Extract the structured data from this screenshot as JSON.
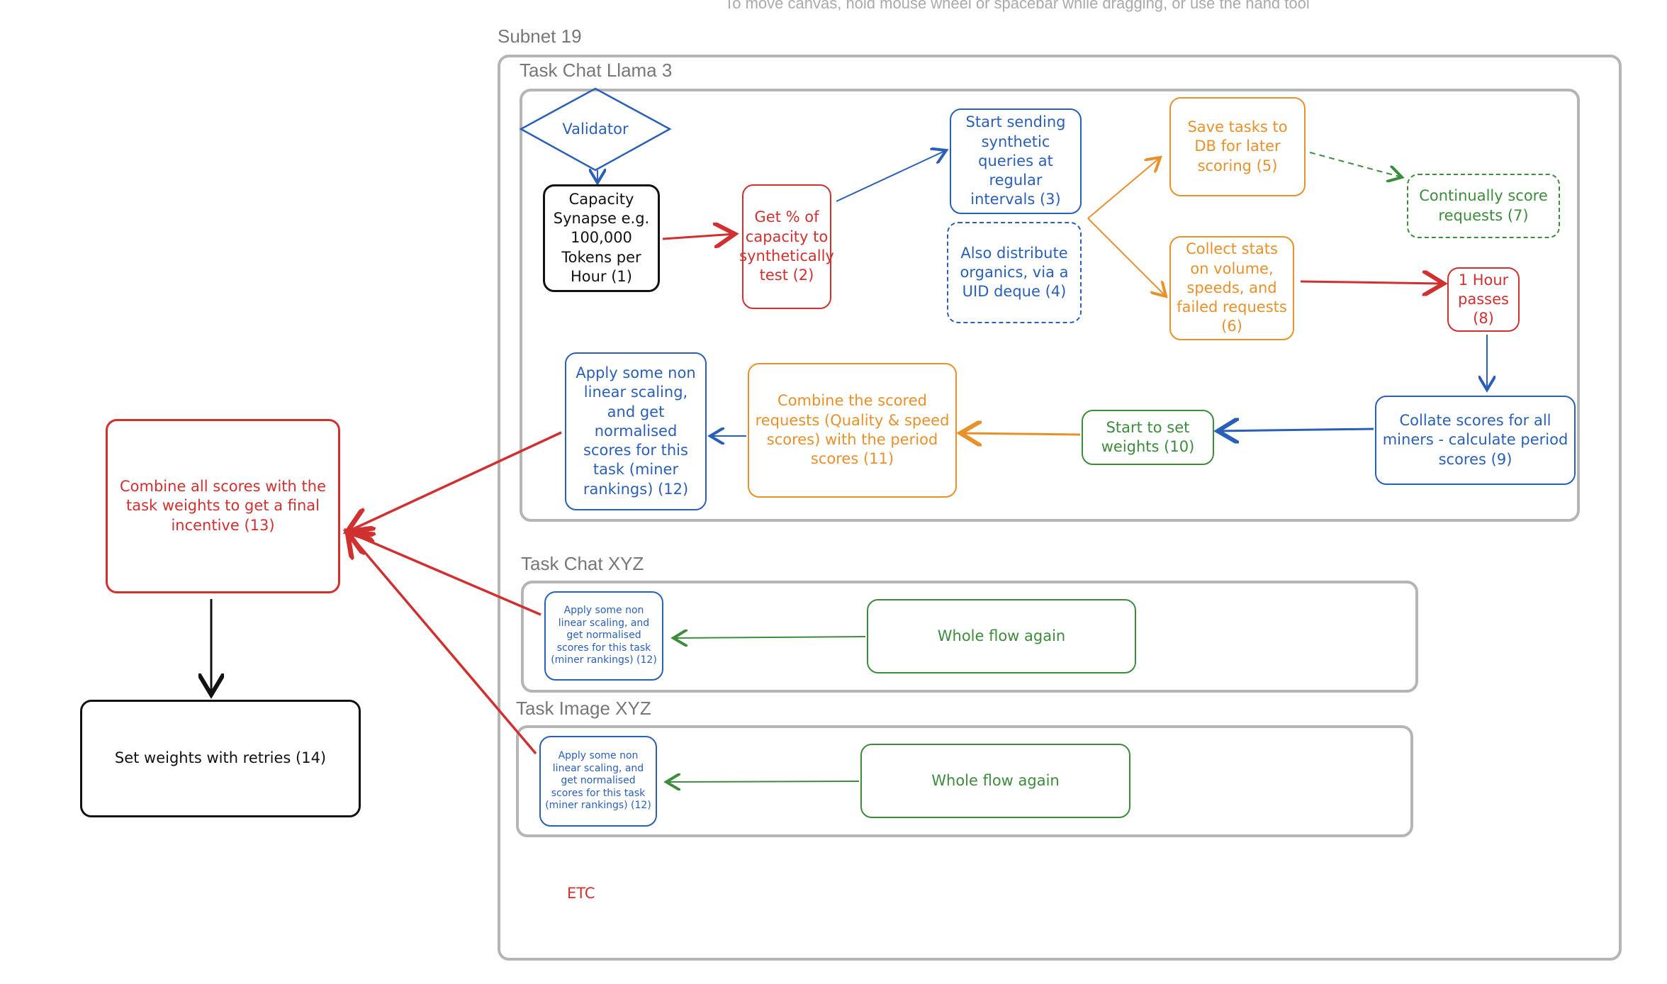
{
  "hint": "To move canvas, hold mouse wheel or spacebar while dragging, or use the hand tool",
  "subnet_label": "Subnet 19",
  "groups": {
    "llama": "Task Chat Llama 3",
    "chat_xyz": "Task Chat XYZ",
    "image_xyz": "Task Image XYZ"
  },
  "nodes": {
    "validator": "Validator",
    "capacity": "Capacity Synapse e.g. 100,000 Tokens per Hour (1)",
    "get_pct": "Get % of capacity to synthetically test (2)",
    "start_sending": "Start sending synthetic queries at regular intervals (3)",
    "distribute": "Also distribute organics, via a UID deque (4)",
    "save_tasks": "Save tasks to DB for later scoring (5)",
    "collect": "Collect stats on volume, speeds, and failed requests (6)",
    "continually": "Continually score requests (7)",
    "hour": "1 Hour passes (8)",
    "collate": "Collate scores for all miners - calculate period scores (9)",
    "start_set": "Start to set weights (10)",
    "combine_scored": "Combine the scored requests (Quality & speed scores) with the period scores (11)",
    "apply": "Apply some non linear scaling, and get normalised scores for this task (miner rankings) (12)",
    "combine_all": "Combine all scores with the task weights to get a final incentive (13)",
    "set_weights": "Set weights with retries (14)",
    "apply_chat": "Apply some non linear scaling, and get normalised scores for this task (miner rankings) (12)",
    "whole_chat": "Whole flow again",
    "apply_image": "Apply some non linear scaling, and get normalised scores for this task (miner rankings) (12)",
    "whole_image": "Whole flow again",
    "etc": "ETC"
  },
  "colors": {
    "blue": "#2a5fb8",
    "red": "#d03030",
    "orange": "#e8902a",
    "green": "#3c8c3c",
    "frame": "#b5b5b5"
  }
}
